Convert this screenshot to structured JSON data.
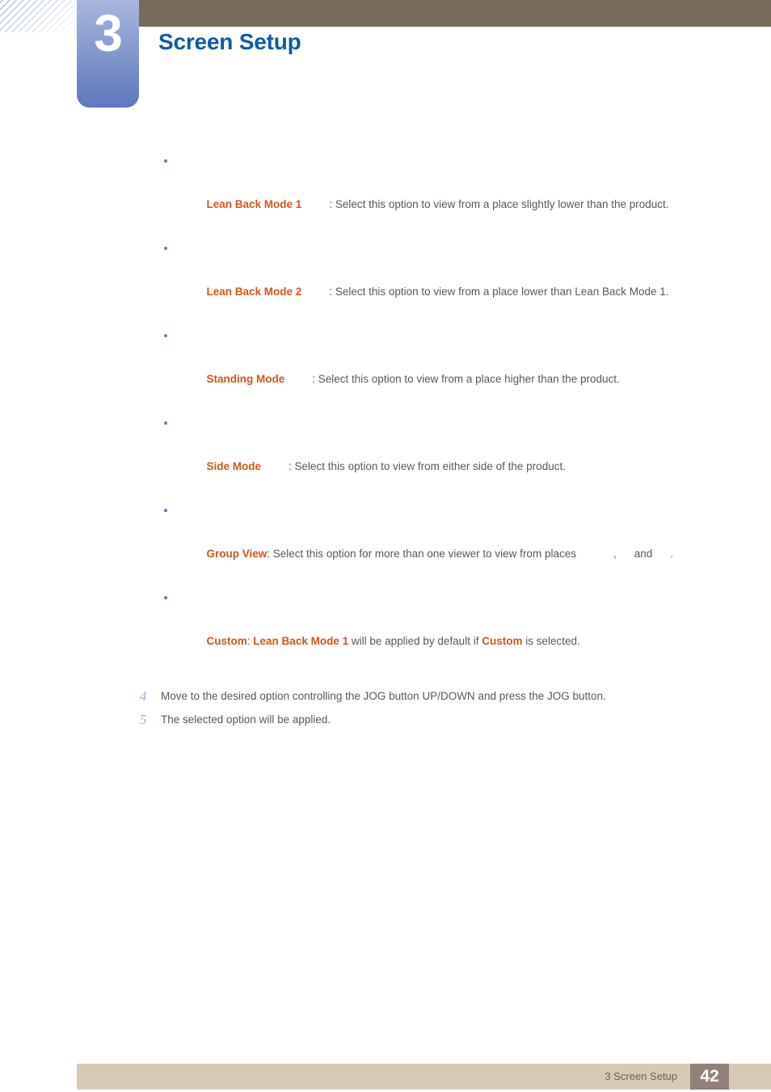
{
  "page": {
    "chapter_number": "3",
    "chapter_title": "Screen Setup",
    "accent_blue": "#0C5CA8",
    "accent_orange": "#D9531E",
    "header_band_color": "#796B5A",
    "badge_gradient_from": "#a8b7de",
    "badge_gradient_to": "#5f78bd",
    "footer_bar_color": "#D7CAB4",
    "footer_page_box_color": "#92817A"
  },
  "bullets": [
    {
      "term": "Lean Back Mode 1",
      "desc": ": Select this option to view from a place slightly lower than the product."
    },
    {
      "term": "Lean Back Mode 2",
      "desc": ": Select this option to view from a place lower than Lean Back Mode 1."
    },
    {
      "term": "Standing Mode",
      "desc": ": Select this option to view from a place higher than the product."
    },
    {
      "term": "Side Mode",
      "desc": ": Select this option to view from either side of the product."
    }
  ],
  "group_view": {
    "term": "Group View",
    "desc_before": ": Select this option for more than one viewer to view from places",
    "separator_comma": ",",
    "separator_and": "and",
    "terminator": "."
  },
  "custom_bullet": {
    "term1": "Custom",
    "colon": ":",
    "term2": "Lean Back Mode 1",
    "mid": " will be applied by default if ",
    "term3": "Custom",
    "tail": " is selected."
  },
  "steps": [
    {
      "number": "4",
      "text": "Move to the desired option controlling the JOG button UP/DOWN and press the JOG button."
    },
    {
      "number": "5",
      "text": "The selected option will be applied."
    }
  ],
  "footer": {
    "label": "3 Screen Setup",
    "page_number": "42"
  }
}
